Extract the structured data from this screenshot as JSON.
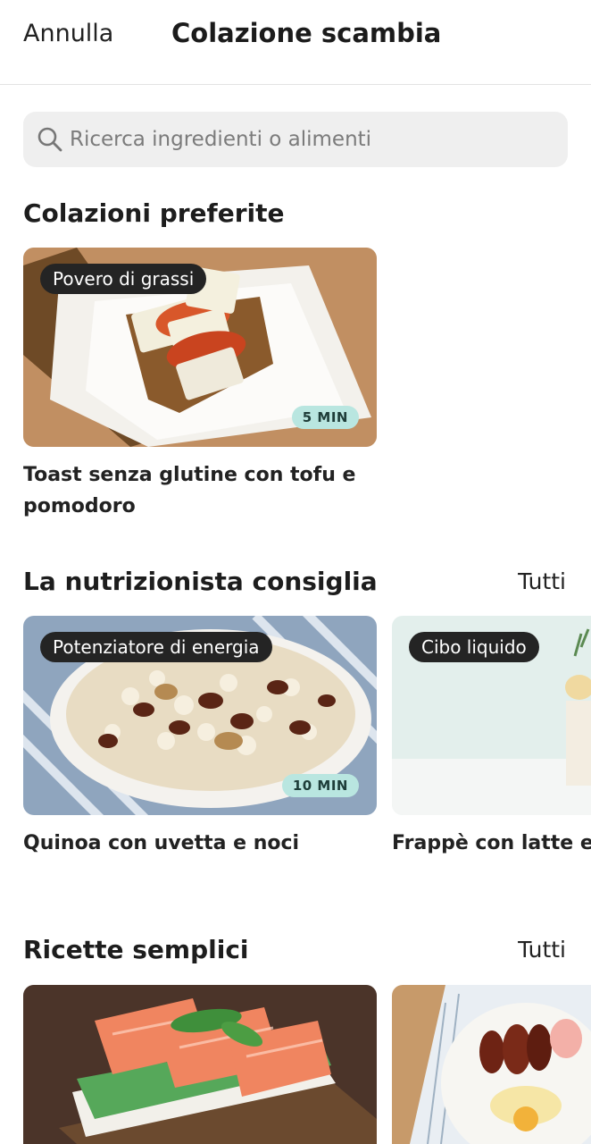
{
  "header": {
    "cancel_label": "Annulla",
    "title": "Colazione scambia"
  },
  "search": {
    "placeholder": "Ricerca ingredienti o alimenti",
    "icon": "search-icon"
  },
  "sections": [
    {
      "title": "Colazioni preferite",
      "see_all": "",
      "cards": [
        {
          "tag": "Povero di grassi",
          "time": "5 MIN",
          "title": "Toast senza glutine con tofu e pomodoro"
        }
      ]
    },
    {
      "title": "La nutrizionista consiglia",
      "see_all": "Tutti",
      "cards": [
        {
          "tag": "Potenziatore di energia",
          "time": "10 MIN",
          "title": "Quinoa con uvetta e noci"
        },
        {
          "tag": "Cibo liquido",
          "time": "",
          "title": "Frappè con latte e banana"
        }
      ]
    },
    {
      "title": "Ricette semplici",
      "see_all": "Tutti",
      "cards": [
        {
          "tag": "",
          "time": "",
          "title": ""
        },
        {
          "tag": "",
          "time": "",
          "title": ""
        }
      ]
    }
  ],
  "colors": {
    "tag_background": "#242424",
    "time_badge_background": "#b9e6e0",
    "search_background": "#efefef"
  }
}
